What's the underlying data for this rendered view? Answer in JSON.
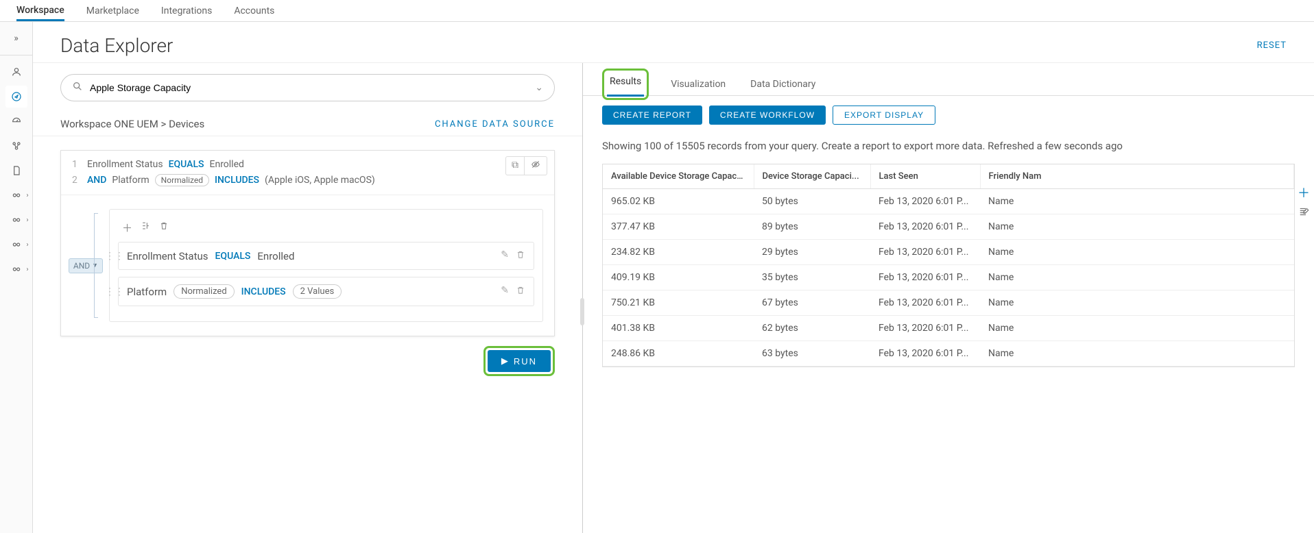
{
  "top_nav": {
    "items": [
      "Workspace",
      "Marketplace",
      "Integrations",
      "Accounts"
    ],
    "active": 0
  },
  "page": {
    "title": "Data Explorer",
    "reset": "RESET"
  },
  "search": {
    "value": "Apple Storage Capacity"
  },
  "breadcrumb": {
    "text": "Workspace ONE UEM > Devices",
    "change": "CHANGE DATA SOURCE"
  },
  "summary": {
    "line1": {
      "num": "1",
      "field": "Enrollment Status",
      "op": "EQUALS",
      "val": "Enrolled"
    },
    "line2": {
      "num": "2",
      "and": "AND",
      "field": "Platform",
      "tag": "Normalized",
      "op": "INCLUDES",
      "vals": "(Apple iOS, Apple macOS)"
    }
  },
  "builder": {
    "and_chip": "AND",
    "cond1": {
      "field": "Enrollment Status",
      "op": "EQUALS",
      "val": "Enrolled"
    },
    "cond2": {
      "field": "Platform",
      "tag": "Normalized",
      "op": "INCLUDES",
      "pill": "2 Values"
    }
  },
  "run_label": "RUN",
  "tabs": {
    "items": [
      "Results",
      "Visualization",
      "Data Dictionary"
    ],
    "active": 0
  },
  "actions": {
    "create_report": "CREATE REPORT",
    "create_workflow": "CREATE WORKFLOW",
    "export": "EXPORT DISPLAY"
  },
  "status_text": "Showing 100 of 15505 records from your query. Create a report to export more data. Refreshed a few seconds ago",
  "table": {
    "columns": [
      "Available Device Storage Capaci...",
      "Device Storage Capaci...",
      "Last Seen",
      "Friendly Nam"
    ],
    "rows": [
      {
        "c0": "965.02 KB",
        "c1": "50 bytes",
        "c2": "Feb 13, 2020 6:01 P...",
        "c3": "Name"
      },
      {
        "c0": "377.47 KB",
        "c1": "89 bytes",
        "c2": "Feb 13, 2020 6:01 P...",
        "c3": "Name"
      },
      {
        "c0": "234.82 KB",
        "c1": "29 bytes",
        "c2": "Feb 13, 2020 6:01 P...",
        "c3": "Name"
      },
      {
        "c0": "409.19 KB",
        "c1": "35 bytes",
        "c2": "Feb 13, 2020 6:01 P...",
        "c3": "Name"
      },
      {
        "c0": "750.21 KB",
        "c1": "67 bytes",
        "c2": "Feb 13, 2020 6:01 P...",
        "c3": "Name"
      },
      {
        "c0": "401.38 KB",
        "c1": "62 bytes",
        "c2": "Feb 13, 2020 6:01 P...",
        "c3": "Name"
      },
      {
        "c0": "248.86 KB",
        "c1": "63 bytes",
        "c2": "Feb 13, 2020 6:01 P...",
        "c3": "Name"
      }
    ]
  }
}
